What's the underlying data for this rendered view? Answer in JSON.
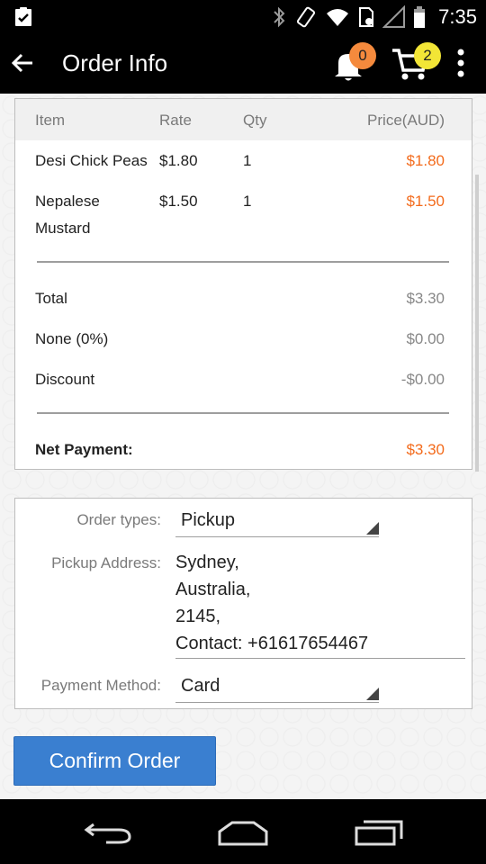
{
  "status_bar": {
    "time": "7:35",
    "icons": [
      "clipboard-check-icon",
      "bluetooth-icon",
      "vibrate-icon",
      "wifi-icon",
      "sim-icon",
      "signal-icon",
      "battery-icon"
    ]
  },
  "app_bar": {
    "title": "Order Info",
    "notification_count": "0",
    "cart_count": "2"
  },
  "order": {
    "columns": [
      "Item",
      "Rate",
      "Qty",
      "Price(AUD)"
    ],
    "rows": [
      {
        "item": "Desi Chick Peas",
        "rate": "$1.80",
        "qty": "1",
        "price": "$1.80"
      },
      {
        "item_line1": "Nepalese",
        "item_line2": "Mustard",
        "rate": "$1.50",
        "qty": "1",
        "price": "$1.50"
      }
    ],
    "total_label": "Total",
    "total_value": "$3.30",
    "tax_label": "None (0%)",
    "tax_value": "$0.00",
    "discount_label": "Discount",
    "discount_value": "-$0.00",
    "net_label": "Net Payment:",
    "net_value": "$3.30"
  },
  "details": {
    "order_type_label": "Order types:",
    "order_type_value": "Pickup",
    "address_label": "Pickup Address:",
    "address_lines": [
      "Sydney,",
      "Australia,",
      "2145,",
      "Contact: +61617654467"
    ],
    "payment_label": "Payment Method:",
    "payment_value": "Card"
  },
  "confirm_button": "Confirm Order",
  "colors": {
    "accent": "#f36b1c",
    "button": "#3a7fd0",
    "badge_notification": "#f58a3d",
    "badge_cart": "#f2e536"
  }
}
